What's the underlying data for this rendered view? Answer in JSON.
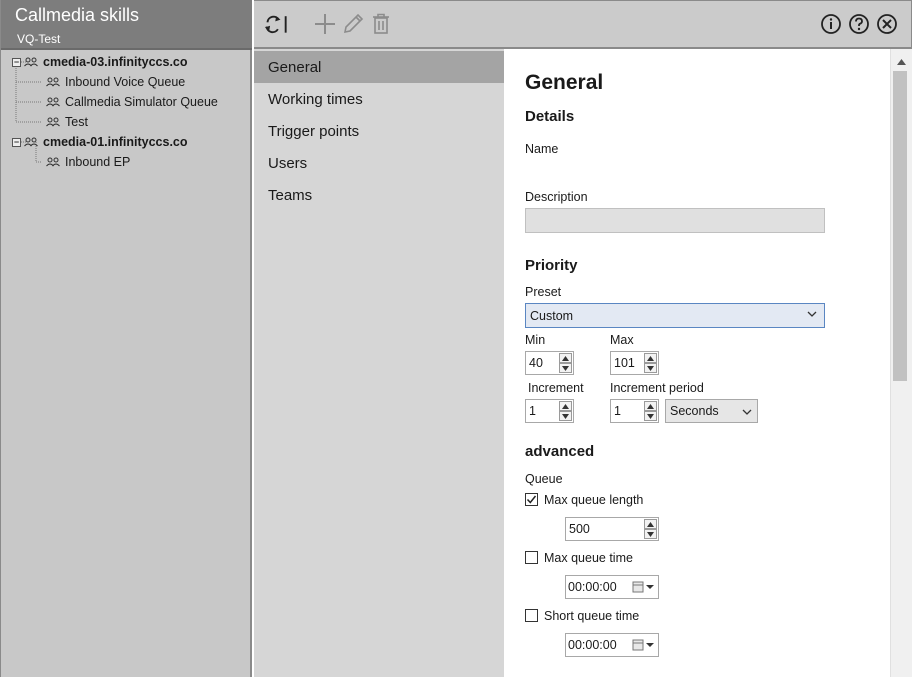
{
  "app": {
    "title": "Callmedia skills",
    "subtitle": "VQ-Test"
  },
  "tree": {
    "nodes": [
      {
        "label": "cmedia-03.infinityccs.co",
        "level": 0,
        "expanded": true,
        "icon": "group-icon"
      },
      {
        "label": "Inbound Voice Queue",
        "level": 1,
        "icon": "group-icon"
      },
      {
        "label": "Callmedia Simulator Queue",
        "level": 1,
        "icon": "group-icon"
      },
      {
        "label": "Test",
        "level": 1,
        "icon": "group-icon"
      },
      {
        "label": "cmedia-01.infinityccs.co",
        "level": 0,
        "expanded": true,
        "icon": "group-icon"
      },
      {
        "label": "Inbound EP",
        "level": 1,
        "icon": "group-icon"
      }
    ]
  },
  "toolbar": {
    "buttons": [
      "refresh-icon",
      "add-icon",
      "edit-icon",
      "delete-icon",
      "info-icon",
      "help-icon",
      "close-icon"
    ]
  },
  "nav": {
    "items": [
      "General",
      "Working times",
      "Trigger points",
      "Users",
      "Teams"
    ],
    "active": "General"
  },
  "general": {
    "title": "General",
    "details_heading": "Details",
    "name_label": "Name",
    "description_label": "Description",
    "description_value": "",
    "priority_heading": "Priority",
    "preset_label": "Preset",
    "preset_value": "Custom",
    "min_label": "Min",
    "min_value": "40",
    "max_label": "Max",
    "max_value": "101",
    "increment_label": "Increment",
    "increment_value": "1",
    "increment_period_label": "Increment period",
    "increment_period_value": "1",
    "increment_period_unit": "Seconds",
    "advanced_heading": "advanced",
    "queue_label": "Queue",
    "max_queue_length_label": "Max queue length",
    "max_queue_length_checked": true,
    "max_queue_length_value": "500",
    "max_queue_time_label": "Max queue time",
    "max_queue_time_checked": false,
    "max_queue_time_value": "00:00:00",
    "short_queue_time_label": "Short queue time",
    "short_queue_time_checked": false,
    "short_queue_time_value": "00:00:00"
  }
}
